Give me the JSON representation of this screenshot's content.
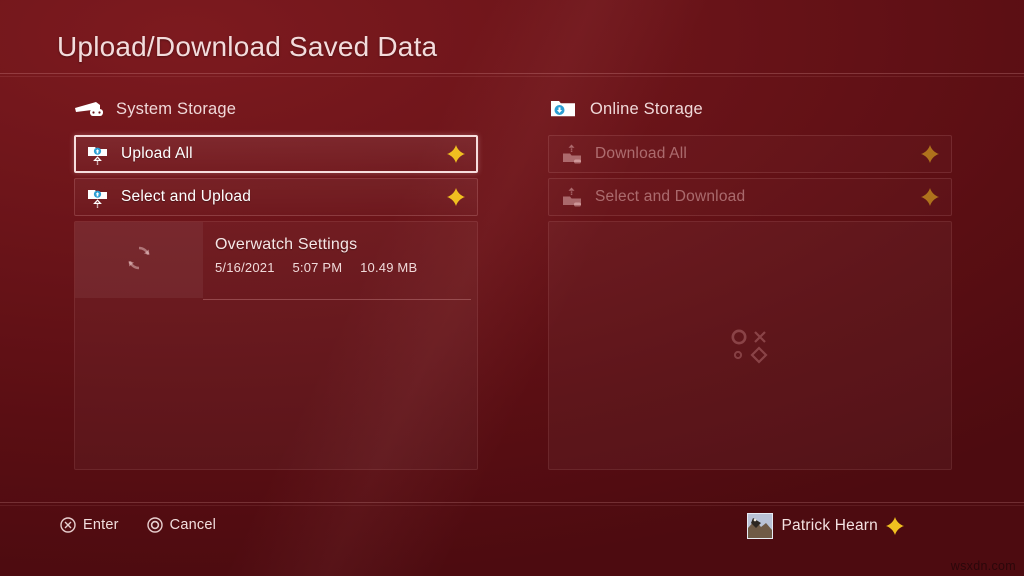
{
  "page": {
    "title": "Upload/Download Saved Data",
    "watermark": "wsxdn.com"
  },
  "colors": {
    "background_dark": "#5a0e13",
    "background_light": "#7d1a1f",
    "accent_plus": "#f0c020",
    "selection_border": "#f7dede",
    "text_primary": "#ffffff",
    "text_muted": "#f0dada",
    "icon_blue": "#2c9fd4"
  },
  "system_storage": {
    "header": {
      "label": "System Storage",
      "icon": "ps4-console-icon"
    },
    "actions": [
      {
        "label": "Upload All",
        "icon": "upload-folder-icon",
        "badge": "ps-plus-icon",
        "selected": true,
        "disabled": false
      },
      {
        "label": "Select and Upload",
        "icon": "upload-folder-icon",
        "badge": "ps-plus-icon",
        "selected": false,
        "disabled": false
      }
    ],
    "save_items": [
      {
        "title": "Overwatch Settings",
        "date": "5/16/2021",
        "time": "5:07 PM",
        "size": "10.49 MB",
        "thumb_icon": "sync-icon"
      }
    ]
  },
  "online_storage": {
    "header": {
      "label": "Online Storage",
      "icon": "download-folder-icon"
    },
    "actions": [
      {
        "label": "Download All",
        "icon": "download-cloud-icon",
        "badge": "ps-plus-icon",
        "selected": false,
        "disabled": true
      },
      {
        "label": "Select and Download",
        "icon": "download-cloud-icon",
        "badge": "ps-plus-icon",
        "selected": false,
        "disabled": true
      }
    ],
    "empty_state": {
      "icon": "ps-face-buttons-icon"
    }
  },
  "footer": {
    "hints": [
      {
        "glyph": "cross-button-icon",
        "label": "Enter"
      },
      {
        "glyph": "circle-button-icon",
        "label": "Cancel"
      }
    ],
    "user": {
      "name": "Patrick Hearn",
      "badge": "ps-plus-icon",
      "avatar": "user-avatar"
    }
  }
}
